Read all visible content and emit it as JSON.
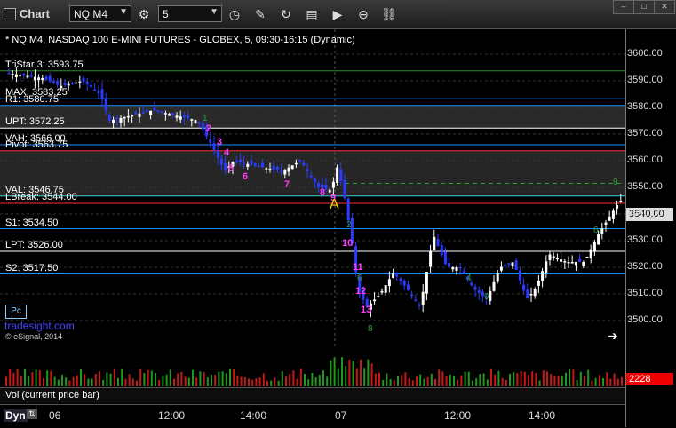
{
  "toolbar": {
    "app_title": "Chart",
    "symbol": "NQ M4",
    "interval": "5",
    "tools": [
      "clock-icon",
      "pencil-icon",
      "cycle-icon",
      "template-icon",
      "play-icon",
      "no-entry-icon",
      "link-icon"
    ]
  },
  "chart_header": "* NQ M4, NASDAQ 100 E-MINI FUTURES - GLOBEX, 5, 09:30-16:15 (Dynamic)",
  "levels": [
    {
      "label": "TriStar 3: 3593.75",
      "price": 3593.75,
      "color": "#2e8b2e"
    },
    {
      "label": "MAX: 3583.25",
      "price": 3583.25,
      "color": "#1e90ff"
    },
    {
      "label": "R1: 3580.75",
      "price": 3580.75,
      "color": "#1e90ff"
    },
    {
      "label": "UPT: 3572.25",
      "price": 3572.25,
      "color": "#ffffff"
    },
    {
      "label": "VAH: 3566.00",
      "price": 3566.0,
      "color": "#1e90ff"
    },
    {
      "label": "Pivot: 3563.75",
      "price": 3563.75,
      "color": "#ff3030"
    },
    {
      "label": "VAL: 3546.75",
      "price": 3546.75,
      "color": "#30d0d0"
    },
    {
      "label": "LBreak: 3544.00",
      "price": 3544.0,
      "color": "#ff3030"
    },
    {
      "label": "S1: 3534.50",
      "price": 3534.5,
      "color": "#1e90ff"
    },
    {
      "label": "LPT: 3526.00",
      "price": 3526.0,
      "color": "#ffffff"
    },
    {
      "label": "S2: 3517.50",
      "price": 3517.5,
      "color": "#1e90ff"
    }
  ],
  "price_axis": {
    "ticks": [
      "3600.00",
      "3590.00",
      "3580.00",
      "3570.00",
      "3560.00",
      "3550.00",
      "3540.00",
      "3530.00",
      "3520.00",
      "3510.00",
      "3500.00"
    ],
    "current_price": "3540.00",
    "current_volume": "2228"
  },
  "time_axis": [
    "06",
    "12:00",
    "14:00",
    "07",
    "12:00",
    "14:00"
  ],
  "annotations": {
    "marker_a": "A",
    "pc_button": "Pc",
    "brand": "tradesight.com",
    "copyright": "© eSignal, 2014",
    "vol_panel_label": "Vol (current price bar)",
    "dyn_label": "Dyn"
  },
  "colors": {
    "bullish": "#ffffff",
    "bearish": "#2a3bff",
    "magenta": "#ff3cff",
    "green_count": "#2ea02e"
  }
}
